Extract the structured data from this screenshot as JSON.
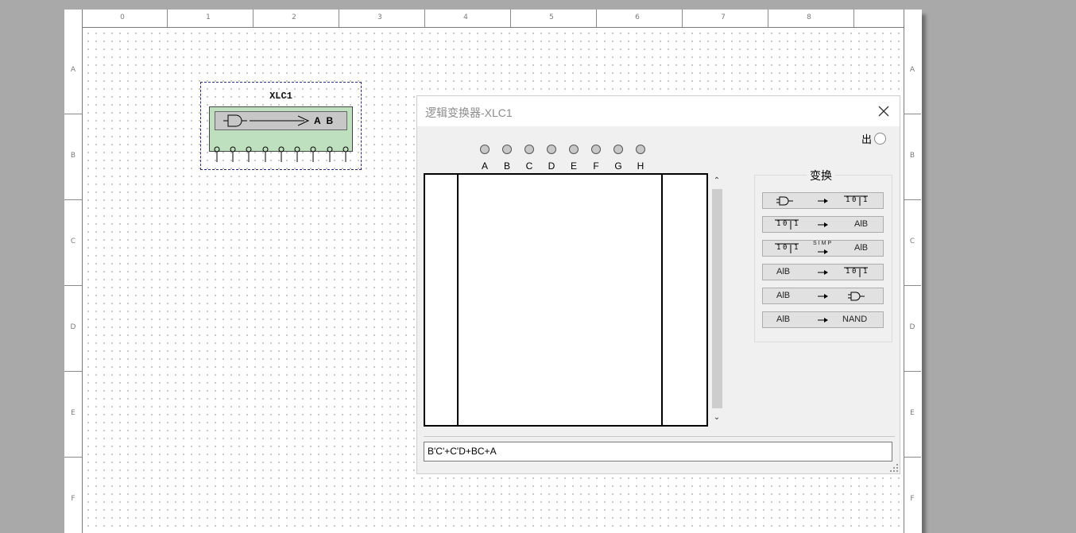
{
  "ruler": {
    "columns": [
      "0",
      "1",
      "2",
      "3",
      "4",
      "5",
      "6",
      "7",
      "8"
    ],
    "rows": [
      "A",
      "B",
      "C",
      "D",
      "E",
      "F"
    ]
  },
  "component": {
    "ref": "XLC1",
    "display_text": "A B",
    "pin_count": 10
  },
  "dialog": {
    "title": "逻辑变换器-XLC1",
    "out_label": "出",
    "inputs": [
      "A",
      "B",
      "C",
      "D",
      "E",
      "F",
      "G",
      "H"
    ],
    "conversions_title": "变换",
    "buttons": [
      {
        "from": "gate",
        "to": "truth-table"
      },
      {
        "from": "truth-table",
        "to": "AlB"
      },
      {
        "from": "truth-table",
        "via": "SIMP",
        "to": "AlB"
      },
      {
        "from": "AlB",
        "to": "truth-table"
      },
      {
        "from": "AlB",
        "to": "gate"
      },
      {
        "from": "AlB",
        "to": "NAND"
      }
    ],
    "button_texts": {
      "alg": "AlB",
      "simp": "SIMP",
      "nand": "NAND",
      "tt_1": "1",
      "tt_0": "0"
    },
    "expression": "B'C'+C'D+BC+A"
  },
  "colors": {
    "component_body": "#bfe0bf",
    "component_border": "#2a2a7a",
    "background": "#a9a9a9"
  }
}
